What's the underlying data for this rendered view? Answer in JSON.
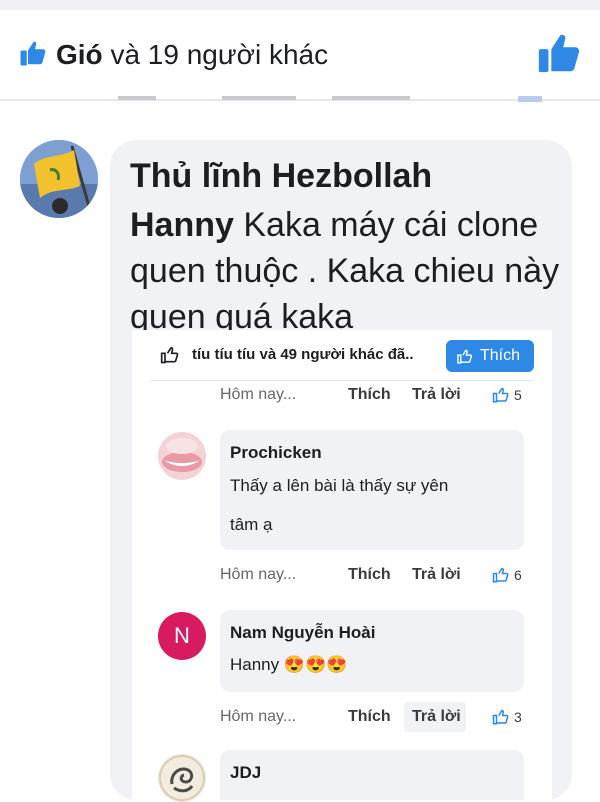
{
  "top_bar": {
    "liker_name": "Gió",
    "likes_summary": " và 19 người khác",
    "like_icon": "thumbs-up-icon",
    "colors": {
      "accent": "#1877f2"
    }
  },
  "main_comment": {
    "author": "Thủ lĩnh Hezbollah",
    "mention": "Hanny",
    "text": "  Kaka máy cái clone quen thuộc . Kaka chieu này quen quá kaka"
  },
  "nested_post": {
    "like_summary": "tíu tíu tíu và 49 người khác đã..",
    "like_button_label": "Thích"
  },
  "comments": [
    {
      "time": "Hôm nay...",
      "like_label": "Thích",
      "reply_label": "Trả lời",
      "likes": "5"
    },
    {
      "author": "Prochicken",
      "text_line1": "Thấy a lên bài là thấy sự yên",
      "text_line2": "tâm ạ",
      "time": "Hôm nay...",
      "like_label": "Thích",
      "reply_label": "Trả lời",
      "likes": "6"
    },
    {
      "author": "Nam Nguyễn Hoài",
      "avatar_letter": "N",
      "text": "Hanny 😍😍😍",
      "time": "Hôm nay...",
      "like_label": "Thích",
      "reply_label": "Trả lời",
      "likes": "3"
    },
    {
      "author": "JDJ"
    }
  ]
}
